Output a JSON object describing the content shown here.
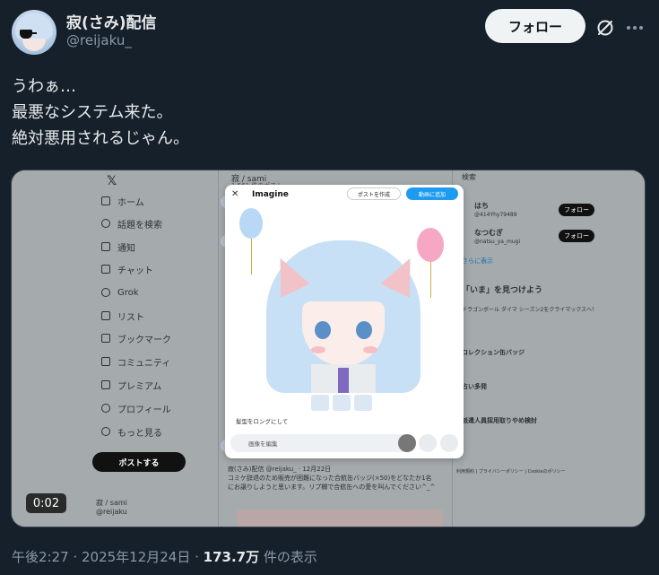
{
  "user": {
    "display_name": "寂(さみ)配信",
    "handle": "@reijaku_"
  },
  "actions": {
    "follow_label": "フォロー",
    "grok_icon": "grok-icon",
    "more_icon": "more-icon"
  },
  "tweet": {
    "lines": [
      "うわぁ…",
      "最悪なシステム来た。",
      "絶対悪用されるじゃん。"
    ]
  },
  "media": {
    "duration": "0:02",
    "screenshot": {
      "nav": {
        "items": [
          "ホーム",
          "話題を検索",
          "通知",
          "チャット",
          "Grok",
          "リスト",
          "ブックマーク",
          "コミュニティ",
          "プレミアム",
          "プロフィール",
          "もっと見る"
        ],
        "post_label": "ポストする",
        "profile_name": "寂 / sami",
        "profile_handle": "@reijaku"
      },
      "center": {
        "title": "寂 / sami",
        "subtitle": "1,561 件のポスト",
        "quote_author": "寂(さみ)配信 @reijaku_ · 12月22日",
        "quote_text": "コミケ辞退のため販売が困難になった合航缶バッジ(×50)をどなたか1名にお譲りしようと思います。リプ欄で合航缶への愛を叫んでください^_^"
      },
      "right": {
        "search_placeholder": "検索",
        "follow_label": "フォロー",
        "suggest_1_name": "はち",
        "suggest_1_handle": "@414Yhy79489",
        "suggest_2_name": "なつむぎ",
        "suggest_2_handle": "@natsu_ya_mugi",
        "show_more": "さらに表示",
        "trends_title": "「いま」を見つけよう",
        "trend_1": "ドラゴンボール ダイマ シーズン2をクライマックスへ！",
        "trend_2": "コレクション缶バッジ",
        "trend_3": "占い多発",
        "trend_4": "派遣人員採用取りやめ検討",
        "footer": "利用規約 | プライバシーポリシー | Cookieのポリシー"
      },
      "modal": {
        "close": "✕",
        "title": "Imagine",
        "post_button": "ポストを作成",
        "animate_button": "動画に追加",
        "prompt_chip": "髪型をロングにして",
        "input_placeholder": "画像を編集"
      }
    }
  },
  "meta": {
    "time": "午後2:27 · 2025年12月24日 · ",
    "views": "173.7万",
    "views_suffix": " 件の表示"
  }
}
